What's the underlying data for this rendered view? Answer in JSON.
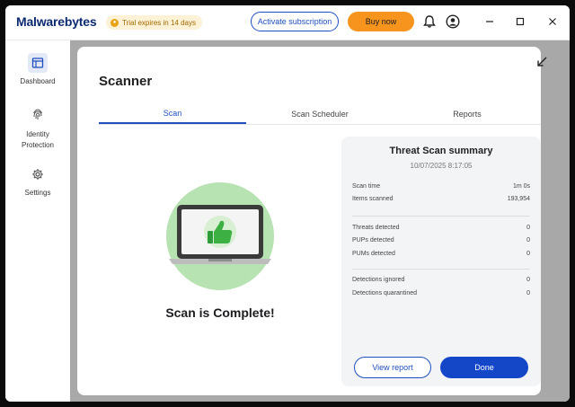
{
  "app": {
    "logo_text": "Malwarebytes",
    "trial_badge": "Trial expires in 14 days",
    "activate_label": "Activate subscription",
    "buy_label": "Buy now"
  },
  "sidebar": {
    "items": [
      {
        "label": "Dashboard",
        "icon": "dashboard-icon",
        "active": true
      },
      {
        "label": "Identity Protection",
        "icon": "fingerprint-icon",
        "active": false
      },
      {
        "label": "Settings",
        "icon": "gear-icon",
        "active": false
      }
    ]
  },
  "scanner": {
    "title": "Scanner",
    "tabs": [
      "Scan",
      "Scan Scheduler",
      "Reports"
    ],
    "active_tab": "Scan",
    "complete_text": "Scan is Complete!"
  },
  "summary": {
    "title": "Threat Scan summary",
    "datetime": "10/07/2025 8:17:05",
    "group1": [
      {
        "label": "Scan time",
        "value": "1m 0s"
      },
      {
        "label": "Items scanned",
        "value": "193,954"
      }
    ],
    "group2": [
      {
        "label": "Threats detected",
        "value": "0"
      },
      {
        "label": "PUPs detected",
        "value": "0"
      },
      {
        "label": "PUMs detected",
        "value": "0"
      }
    ],
    "group3": [
      {
        "label": "Detections ignored",
        "value": "0"
      },
      {
        "label": "Detections quarantined",
        "value": "0"
      }
    ],
    "view_report_label": "View report",
    "done_label": "Done"
  },
  "colors": {
    "brand_blue": "#1f4fbf",
    "buy_orange": "#f7941d",
    "success_green": "#3cb043"
  }
}
